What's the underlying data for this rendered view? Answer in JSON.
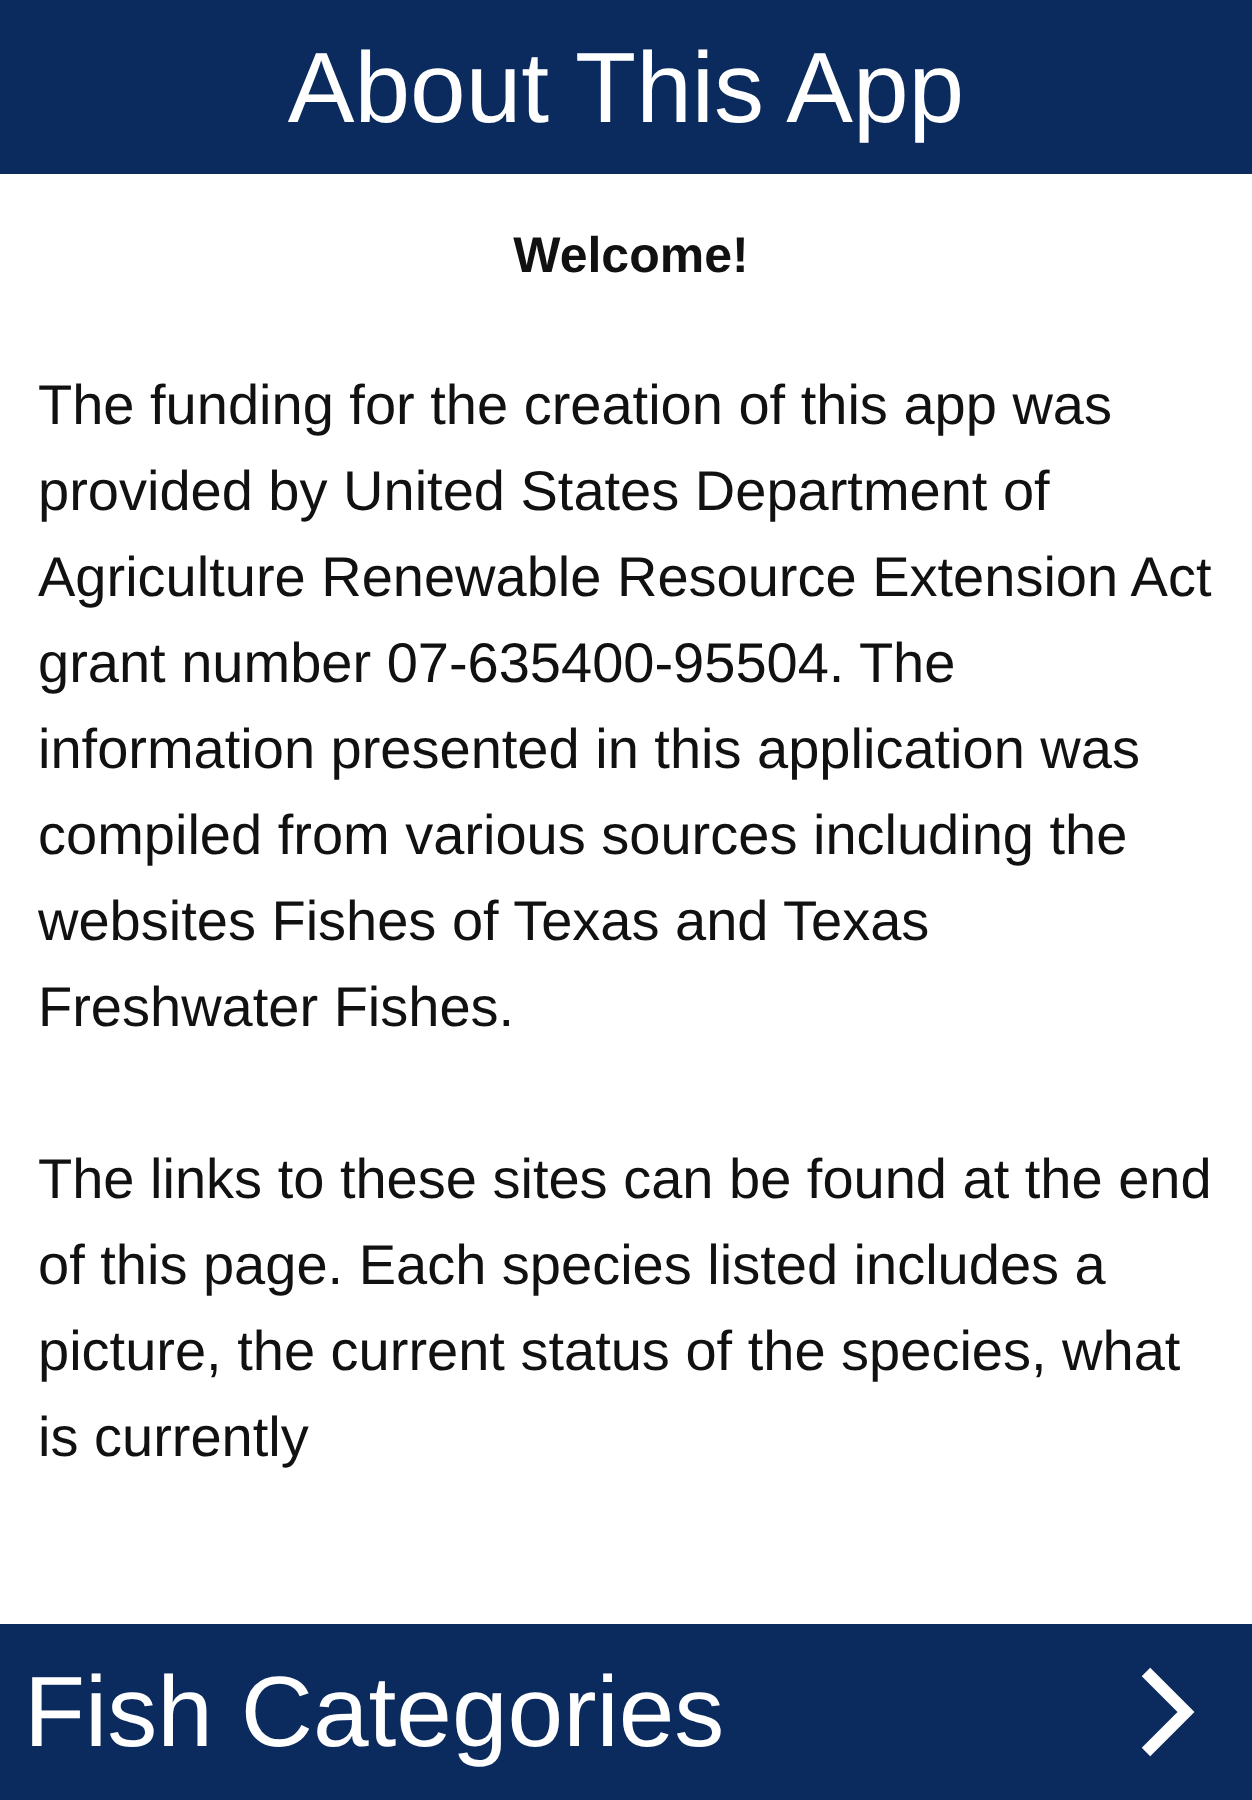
{
  "header": {
    "title": "About This App"
  },
  "content": {
    "heading": "Welcome!",
    "paragraphs": [
      "The funding for the creation of this app was provided by United States Department of Agriculture Renewable Resource Extension Act grant number 07-635400-95504. The information presented in this application was compiled from various sources including the websites Fishes of Texas and Texas Freshwater Fishes.",
      "The links to these sites can be found at the end of this page. Each species listed includes a picture, the current status of the species, what is currently"
    ]
  },
  "footer": {
    "label": "Fish Categories"
  }
}
